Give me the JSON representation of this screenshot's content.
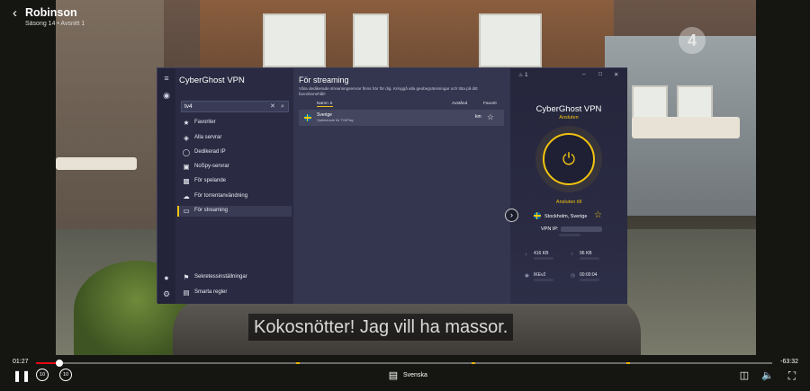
{
  "player": {
    "title": "Robinson",
    "episode": "Säsong 14 • Avsnitt 1",
    "subtitle": "Kokosnötter! Jag vill ha massor.",
    "elapsed": "01:27",
    "remaining": "-63:32",
    "progress_fraction": 0.032,
    "subtitle_language": "Svenska",
    "channel_logo": "4",
    "skip_back_label": "10",
    "skip_forward_label": "10"
  },
  "vpn": {
    "app_name": "CyberGhost VPN",
    "search": {
      "value": "tv4",
      "placeholder": ""
    },
    "nav_items": [
      {
        "label": "Favoriter",
        "icon": "star-icon"
      },
      {
        "label": "Alla servrar",
        "icon": "globe-icon"
      },
      {
        "label": "Dedikerad IP",
        "icon": "user-ip-icon"
      },
      {
        "label": "NoSpy-servrar",
        "icon": "lock-icon"
      },
      {
        "label": "För spelande",
        "icon": "gamepad-icon"
      },
      {
        "label": "För torrentanvändning",
        "icon": "cloud-icon"
      },
      {
        "label": "För streaming",
        "icon": "tv-icon"
      }
    ],
    "bottom_items": [
      {
        "label": "Sekretessinställningar",
        "icon": "privacy-icon"
      },
      {
        "label": "Smarta regler",
        "icon": "rules-icon"
      }
    ],
    "section_title": "För streaming",
    "section_desc": "Våra dedikerade streamingservrar finns här för dig. Kringgå alla geobegränsningar och titta på ditt favoritinnehåll!",
    "columns": {
      "name": "Namn",
      "distance": "Avstånd",
      "favorite": "Favorit"
    },
    "server": {
      "name": "Sverige",
      "subtitle": "Optimerade för TV4Play",
      "distance": "km"
    },
    "status": {
      "notification_count": "1",
      "title": "CyberGhost VPN",
      "state": "Ansluten",
      "connected_to": "Ansluten till",
      "location": "Stockholm, Sverige",
      "vpn_ip_label": "VPN IP:",
      "download": "416 KB",
      "upload": "96 KB",
      "protocol": "IKEv2",
      "duration": "00:00:04"
    }
  },
  "colors": {
    "accent": "#f2c40f",
    "progress": "#e50914",
    "panel": "#2c2d44"
  }
}
